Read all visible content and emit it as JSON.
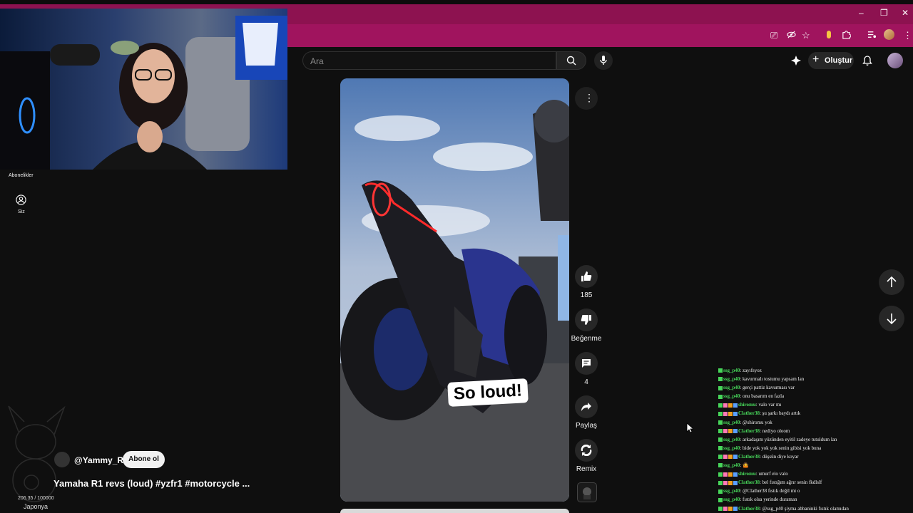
{
  "browser": {
    "window_controls": [
      "–",
      "❐",
      "✕"
    ],
    "toolbar_icons": [
      "cast-icon",
      "eye-off-icon",
      "star-icon",
      "extension-icon",
      "puzzle-icon",
      "media-icon",
      "profile-icon",
      "menu-icon"
    ]
  },
  "header": {
    "search_placeholder": "Ara",
    "create_label": "Oluştur"
  },
  "sidebar": {
    "subscriptions_label": "Abonelikler",
    "you_label": "Siz"
  },
  "short": {
    "caption": "So loud!",
    "channel": "@Yammy_R1",
    "subscribe_label": "Abone ol",
    "title": "Yamaha R1 revs (loud) #yzfr1 #motorcycle ..."
  },
  "actions": {
    "likes": "185",
    "dislike_label": "Beğenme",
    "comments": "4",
    "share_label": "Paylaş",
    "remix_label": "Remix"
  },
  "stream_overlay": {
    "counter": "206.35 / 100000",
    "country": "Japonya"
  },
  "colors": {
    "browser_frame": "#8d1250",
    "chat_user_green": "#47d65a",
    "page_background": "#0f0f0f"
  },
  "chat": [
    {
      "user": "ssg_p40",
      "msg": "zayıfsyoz",
      "badges": 1
    },
    {
      "user": "ssg_p40",
      "msg": "kavurmalı tostumu yapsam lan",
      "badges": 1
    },
    {
      "user": "ssg_p40",
      "msg": "gerçi pattiz kavurması var",
      "badges": 1
    },
    {
      "user": "ssg_p40",
      "msg": "onu basarım en fazla",
      "badges": 1
    },
    {
      "user": "shiromu",
      "msg": "valo var mı",
      "badges": 4
    },
    {
      "user": "Clather38",
      "msg": "şu şarkı baydı artık",
      "badges": 4
    },
    {
      "user": "ssg_p40",
      "msg": "@shiromu yok",
      "badges": 1
    },
    {
      "user": "Clather38",
      "msg": "nediyo oloom",
      "badges": 4
    },
    {
      "user": "ssg_p40",
      "msg": "arkadaşım yüzünden eyitil zadeye tutuldum lan",
      "badges": 1
    },
    {
      "user": "ssg_p40",
      "msg": "bide yok yok yok senin gibisi yok buna",
      "badges": 1
    },
    {
      "user": "Clather38",
      "msg": "düşsün diye koyar",
      "badges": 4
    },
    {
      "user": "ssg_p40",
      "msg": "🤷",
      "badges": 1
    },
    {
      "user": "shiromu",
      "msg": "umurf elo valo",
      "badges": 4
    },
    {
      "user": "Clather38",
      "msg": "bel fıstığım ağrır senin fkdlslf",
      "badges": 4
    },
    {
      "user": "ssg_p40",
      "msg": "@Clather38 fıstık değil mi o",
      "badges": 1
    },
    {
      "user": "ssg_p40",
      "msg": "fıstık olsa yerinde duraman",
      "badges": 1
    },
    {
      "user": "Clather38",
      "msg": "@ssg_p40 şiyma abbaninki fıstık olamıdan",
      "badges": 4
    }
  ]
}
